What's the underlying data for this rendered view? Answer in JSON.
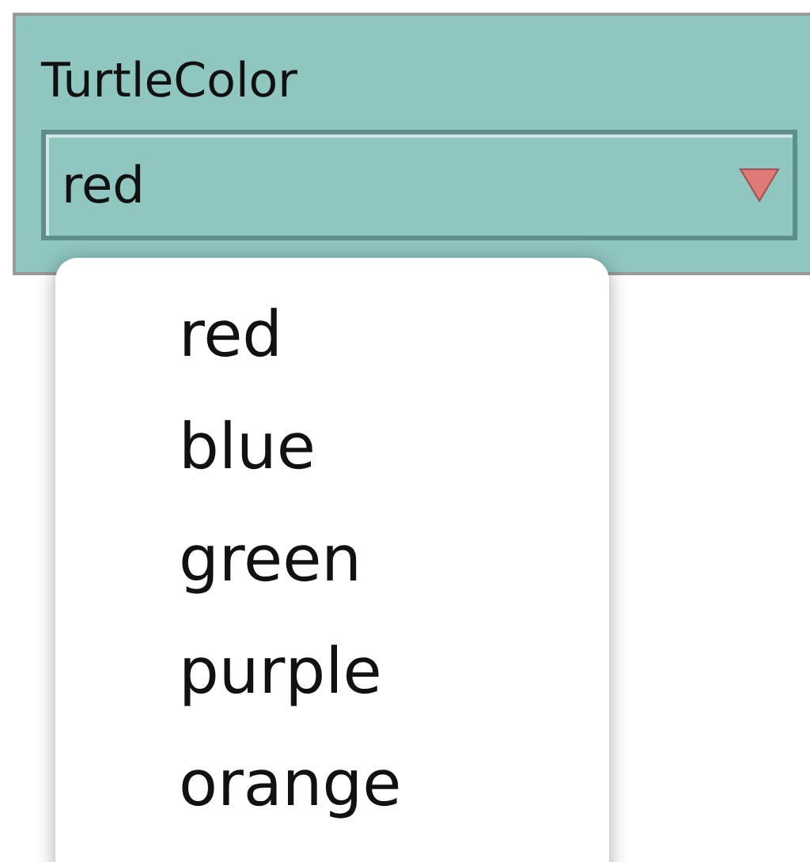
{
  "chooser": {
    "label": "TurtleColor",
    "value": "red"
  },
  "menu": {
    "items": [
      "red",
      "blue",
      "green",
      "purple",
      "orange"
    ]
  }
}
